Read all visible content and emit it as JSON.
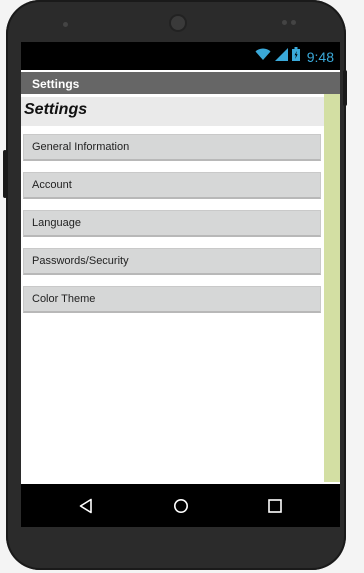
{
  "device": {
    "body_color": "#2b2b2b"
  },
  "status_bar": {
    "time": "9:48",
    "icons": [
      "wifi-icon",
      "signal-icon",
      "battery-icon"
    ],
    "accent": "#3aa9d9"
  },
  "app": {
    "title": "Settings"
  },
  "screen": {
    "heading": "Settings",
    "buttons": [
      {
        "label": "General Information"
      },
      {
        "label": "Account"
      },
      {
        "label": "Language"
      },
      {
        "label": "Passwords/Security"
      },
      {
        "label": "Color Theme"
      }
    ],
    "sidebar_color": "#d3dfa3"
  },
  "nav_bar": {
    "items": [
      "back-icon",
      "home-icon",
      "recents-icon"
    ]
  }
}
